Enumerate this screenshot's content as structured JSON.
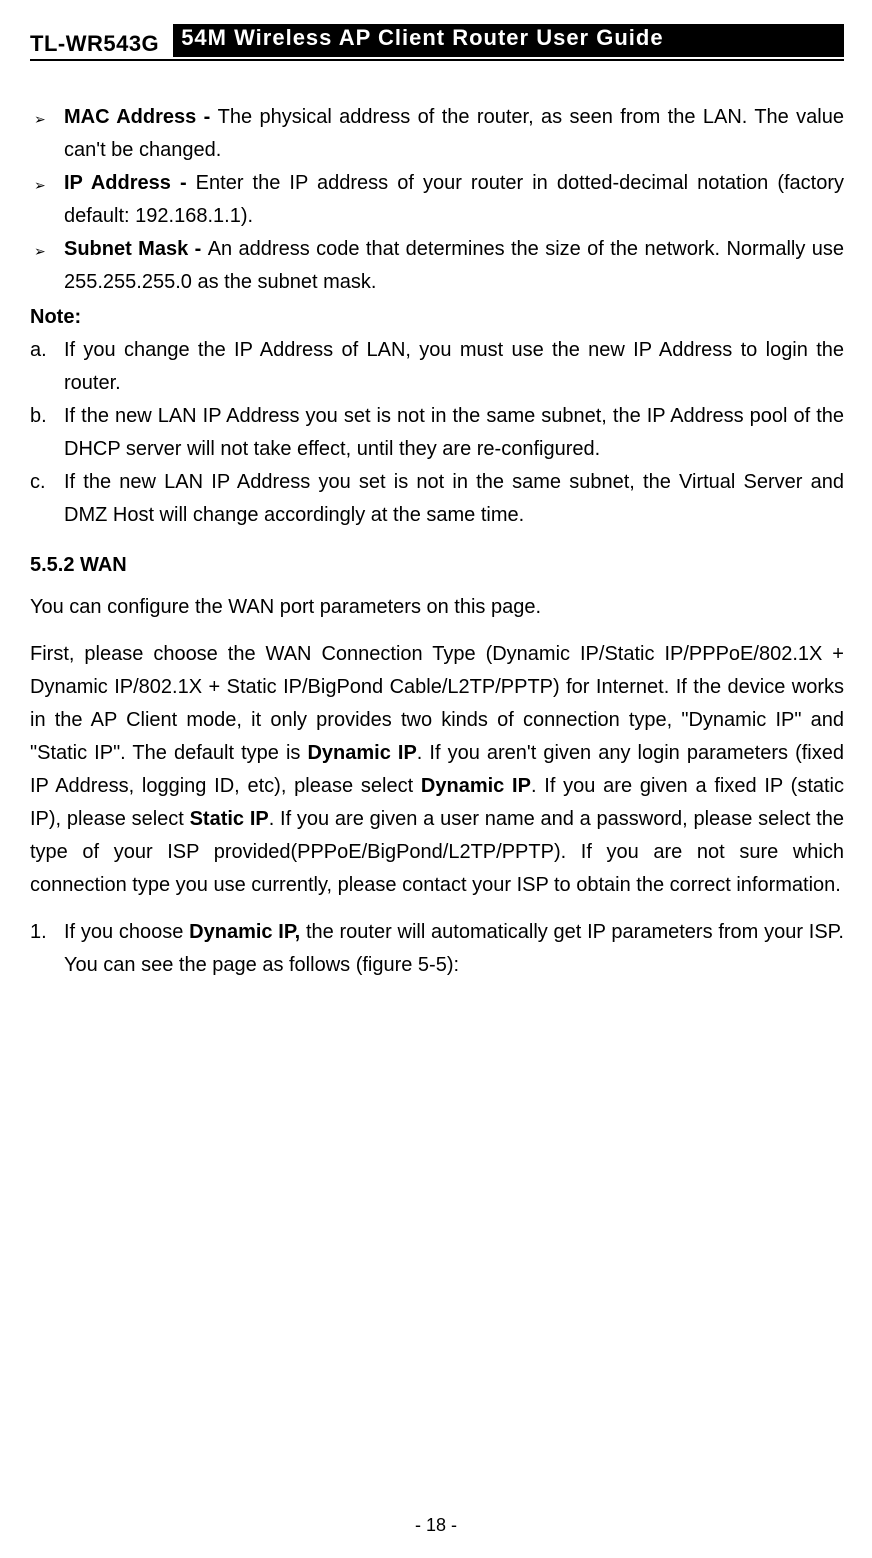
{
  "header": {
    "model": "TL-WR543G",
    "title": "54M Wireless AP Client Router User Guide"
  },
  "bullets": [
    {
      "term": "MAC Address - ",
      "desc": "The physical address of the router, as seen from the LAN. The value can't be changed."
    },
    {
      "term": "IP Address - ",
      "desc": "Enter the IP address of your router in dotted-decimal notation (factory default: 192.168.1.1)."
    },
    {
      "term": "Subnet Mask - ",
      "desc": "An address code that determines the size of the network. Normally use 255.255.255.0 as the subnet mask."
    }
  ],
  "note_label": "Note:",
  "notes": [
    {
      "marker": "a.",
      "text": "If you change the IP Address of LAN, you must use the new IP Address to login the router."
    },
    {
      "marker": "b.",
      "text": "If the new LAN IP Address you set is not in the same subnet, the IP Address pool of the DHCP server will not take effect, until they are re-configured."
    },
    {
      "marker": "c.",
      "text": "If the new LAN IP Address you set is not in the same subnet, the Virtual Server and DMZ Host will change accordingly at the same time."
    }
  ],
  "section": {
    "heading": "5.5.2 WAN",
    "para1": "You can configure the WAN port parameters on this page.",
    "para2_parts": {
      "p1": "First, please choose the WAN Connection Type (Dynamic IP/Static IP/PPPoE/802.1X + Dynamic IP/802.1X + Static IP/BigPond Cable/L2TP/PPTP) for Internet. If the device works in the AP Client mode, it only provides two kinds of connection type, \"Dynamic IP\" and \"Static IP\". The default type is ",
      "b1": "Dynamic IP",
      "p2": ". If you aren't given any login parameters (fixed IP Address, logging ID, etc), please select ",
      "b2": "Dynamic IP",
      "p3": ". If you are given a fixed IP (static IP), please select ",
      "b3": "Static IP",
      "p4": ". If you are given a user name and a password, please select the type of your ISP provided(PPPoE/BigPond/L2TP/PPTP). If you are not sure which connection type you use currently, please contact your ISP to obtain the correct information."
    },
    "numbered": {
      "marker": "1.",
      "pre": "If you choose ",
      "bold": "Dynamic IP,",
      "post": " the router will automatically get IP parameters from your ISP. You can see the page as follows (figure 5-5):"
    }
  },
  "footer": "- 18 -"
}
